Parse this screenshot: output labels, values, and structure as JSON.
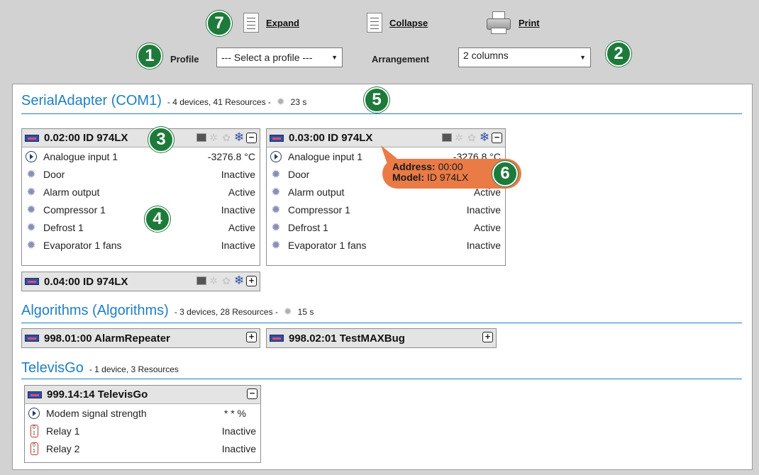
{
  "toolbar": {
    "expand_label": "Expand",
    "collapse_label": "Collapse",
    "print_label": "Print",
    "profile_label": "Profile",
    "profile_value": "--- Select a profile ---",
    "arrangement_label": "Arrangement",
    "arrangement_value": "2 columns"
  },
  "callouts": [
    "1",
    "2",
    "3",
    "4",
    "5",
    "6",
    "7"
  ],
  "groups": [
    {
      "name": "SerialAdapter",
      "suffix": "(COM1)",
      "info": "- 4 devices, 41 Resources -",
      "time": "23 s"
    },
    {
      "name": "Algorithms",
      "suffix": "(Algorithms)",
      "info": "- 3 devices, 28 Resources -",
      "time": "15 s"
    },
    {
      "name": "TelevisGo",
      "suffix": "",
      "info": "- 1 device, 3 Resources",
      "time": ""
    }
  ],
  "devices": {
    "d1": {
      "title": "0.02:00  ID 974LX",
      "rows": [
        {
          "name": "Analogue input 1",
          "value": "-3276.8 °C"
        },
        {
          "name": "Door",
          "value": "Inactive"
        },
        {
          "name": "Alarm output",
          "value": "Active"
        },
        {
          "name": "Compressor 1",
          "value": "Inactive"
        },
        {
          "name": "Defrost 1",
          "value": "Active"
        },
        {
          "name": "Evaporator 1 fans",
          "value": "Inactive"
        }
      ]
    },
    "d2": {
      "title": "0.03:00  ID 974LX",
      "rows": [
        {
          "name": "Analogue input 1",
          "value": "-3276.8 °C"
        },
        {
          "name": "Door",
          "value": ""
        },
        {
          "name": "Alarm output",
          "value": "Active"
        },
        {
          "name": "Compressor 1",
          "value": "Inactive"
        },
        {
          "name": "Defrost 1",
          "value": "Active"
        },
        {
          "name": "Evaporator 1 fans",
          "value": "Inactive"
        }
      ]
    },
    "d3": {
      "title": "0.04:00  ID 974LX"
    },
    "d4": {
      "title": "998.01:00 AlarmRepeater"
    },
    "d5": {
      "title": "998.02:01 TestMAXBug"
    },
    "d6": {
      "title": "999.14:14 TelevisGo",
      "rows": [
        {
          "name": "Modem signal strength",
          "value": "* * %"
        },
        {
          "name": "Relay 1",
          "value": "Inactive"
        },
        {
          "name": "Relay 2",
          "value": "Inactive"
        }
      ]
    }
  },
  "tooltip": {
    "address_label": "Address:",
    "address_value": "00:00",
    "model_label": "Model:",
    "model_value": "ID 974LX"
  },
  "colors": {
    "accent": "#1f7fc4",
    "badge": "#1d7a3b",
    "tooltip": "#ea7b47",
    "snowflake": "#2c4ea3"
  }
}
